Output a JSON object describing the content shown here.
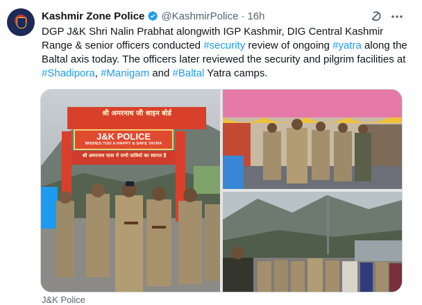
{
  "author": {
    "name": "Kashmir Zone Police",
    "handle": "@KashmirPolice",
    "separator": "·",
    "time": "16h",
    "verified_color": "#1d9bf0"
  },
  "tweet": {
    "segments": [
      {
        "text": "DGP J&K Shri Nalin Prabhat alongwith IGP Kashmir, DIG Central Kashmir Range & senior officers conducted ",
        "link": false
      },
      {
        "text": "#security",
        "link": true
      },
      {
        "text": " review of ongoing ",
        "link": false
      },
      {
        "text": "#yatra",
        "link": true
      },
      {
        "text": " along the Baltal axis today. The officers later reviewed the security and pilgrim facilities at ",
        "link": false
      },
      {
        "text": "#Shadipora",
        "link": true
      },
      {
        "text": ", ",
        "link": false
      },
      {
        "text": "#Manigam",
        "link": true
      },
      {
        "text": " and ",
        "link": false
      },
      {
        "text": "#Baltal",
        "link": true
      },
      {
        "text": " Yatra camps.",
        "link": false
      }
    ],
    "link_color": "#1d9bf0"
  },
  "media": {
    "photo1_banner": {
      "top_line": "श्री अमरनाथ जी श्राइन बोर्ड",
      "title": "J&K POLICE",
      "subtitle": "WISHES YOU A HAPPY & SAFE YATRA",
      "bottom_line": "श्री अमरनाथ यात्रा में सभी यात्रियों का स्वागत है"
    }
  },
  "caption": "J&K Police",
  "icons": {
    "verified": "verified-badge-icon",
    "grok": "grok-icon",
    "more": "more-options-icon"
  }
}
